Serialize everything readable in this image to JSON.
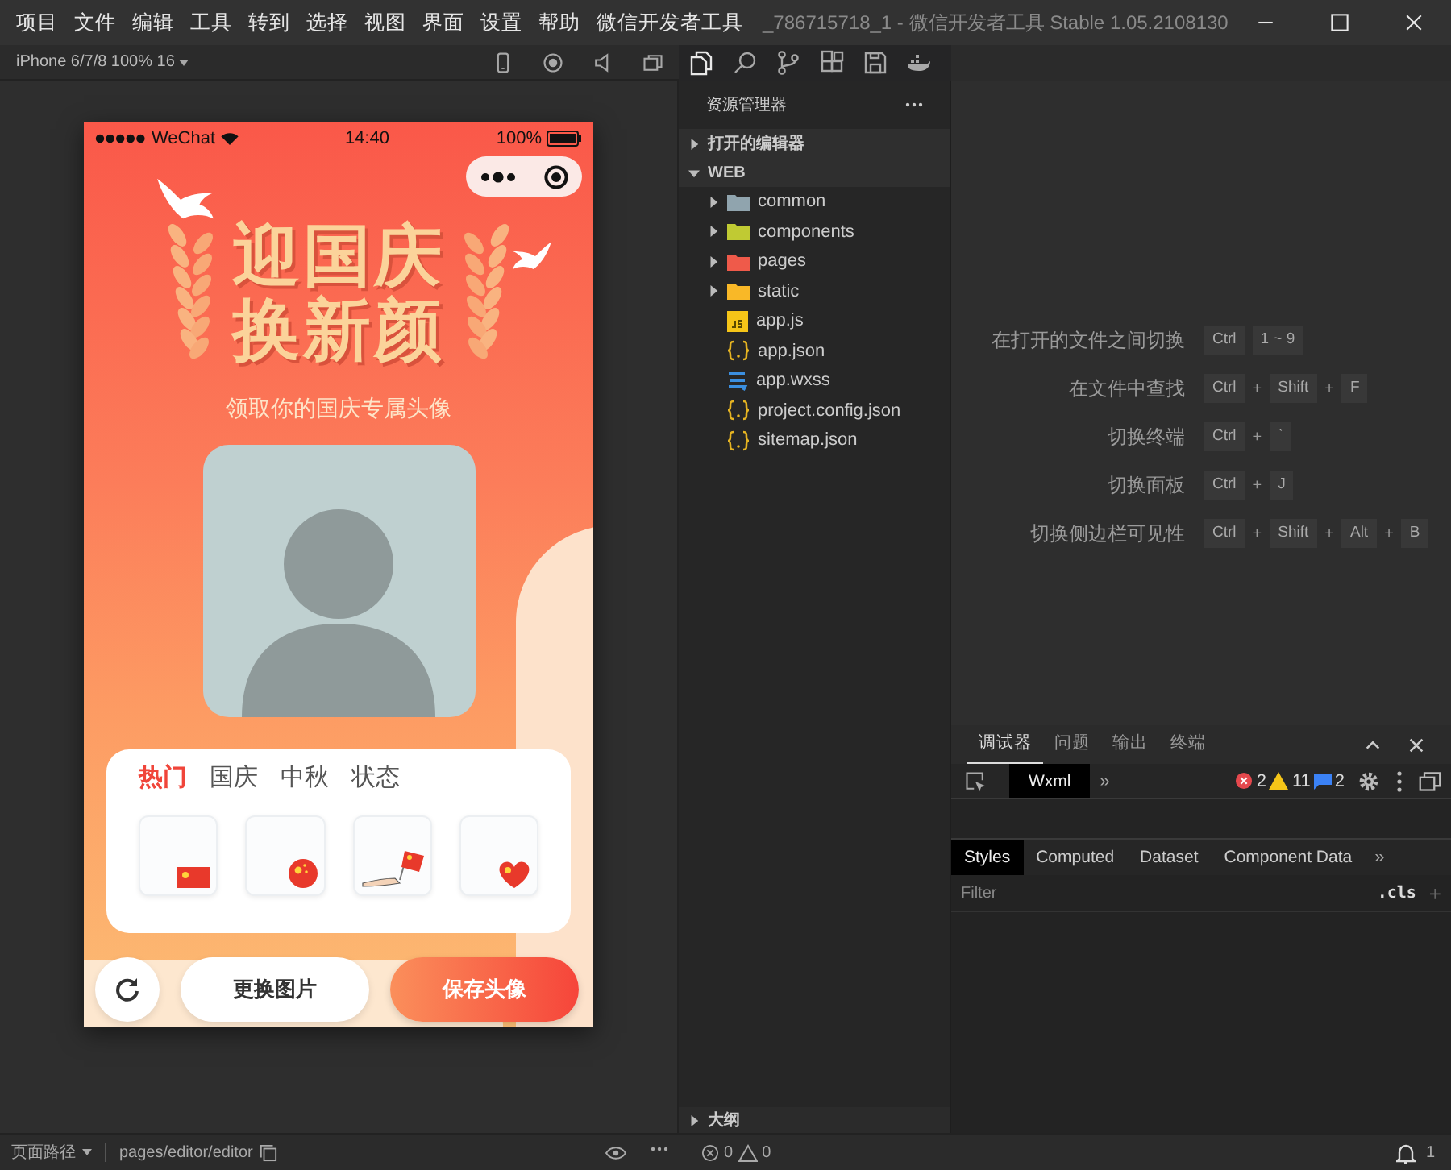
{
  "menu": [
    "项目",
    "文件",
    "编辑",
    "工具",
    "转到",
    "选择",
    "视图",
    "界面",
    "设置",
    "帮助",
    "微信开发者工具"
  ],
  "window": {
    "title": "_786715718_1 - 微信开发者工具 Stable 1.05.2108130"
  },
  "simulator": {
    "device": "iPhone 6/7/8 100% 16"
  },
  "phone": {
    "status": {
      "carrier": "WeChat",
      "time": "14:40",
      "battery": "100%"
    },
    "headline": [
      "迎国庆",
      "换新颜"
    ],
    "subtitle": "领取你的国庆专属头像",
    "tabs": [
      {
        "label": "热门",
        "selected": true
      },
      {
        "label": "国庆",
        "selected": false
      },
      {
        "label": "中秋",
        "selected": false
      },
      {
        "label": "状态",
        "selected": false
      }
    ],
    "frames": [
      {
        "kind": "flag"
      },
      {
        "kind": "badge"
      },
      {
        "kind": "hand-flag"
      },
      {
        "kind": "heart"
      }
    ],
    "buttons": [
      {
        "kind": "refresh"
      },
      {
        "kind": "secondary",
        "label": "更换图片"
      },
      {
        "kind": "primary",
        "label": "保存头像"
      }
    ]
  },
  "explorer": {
    "title": "资源管理器",
    "sections": [
      {
        "label": "打开的编辑器",
        "expanded": false
      },
      {
        "label": "WEB",
        "expanded": true,
        "children": [
          {
            "kind": "folder",
            "label": "common",
            "color": "#90a4ae",
            "expanded": false
          },
          {
            "kind": "folder",
            "label": "components",
            "color": "#c0ca33",
            "expanded": false
          },
          {
            "kind": "folder",
            "label": "pages",
            "color": "#ef5a4a",
            "expanded": false
          },
          {
            "kind": "folder",
            "label": "static",
            "color": "#f9b827",
            "expanded": false
          },
          {
            "kind": "js",
            "label": "app.js"
          },
          {
            "kind": "json",
            "label": "app.json"
          },
          {
            "kind": "wxss",
            "label": "app.wxss"
          },
          {
            "kind": "json",
            "label": "project.config.json"
          },
          {
            "kind": "json",
            "label": "sitemap.json"
          }
        ]
      }
    ],
    "outline": {
      "label": "大纲",
      "expanded": false
    }
  },
  "shortcuts": [
    {
      "label": "在打开的文件之间切换",
      "keys": [
        {
          "kind": "key",
          "text": "Ctrl"
        },
        {
          "kind": "key",
          "text": "1 ~ 9"
        }
      ]
    },
    {
      "label": "在文件中查找",
      "keys": [
        {
          "kind": "key",
          "text": "Ctrl"
        },
        {
          "kind": "plus",
          "text": "+"
        },
        {
          "kind": "key",
          "text": "Shift"
        },
        {
          "kind": "plus",
          "text": "+"
        },
        {
          "kind": "key",
          "text": "F"
        }
      ]
    },
    {
      "label": "切换终端",
      "keys": [
        {
          "kind": "key",
          "text": "Ctrl"
        },
        {
          "kind": "plus",
          "text": "+"
        },
        {
          "kind": "key",
          "text": "`"
        }
      ]
    },
    {
      "label": "切换面板",
      "keys": [
        {
          "kind": "key",
          "text": "Ctrl"
        },
        {
          "kind": "plus",
          "text": "+"
        },
        {
          "kind": "key",
          "text": "J"
        }
      ]
    },
    {
      "label": "切换侧边栏可见性",
      "keys": [
        {
          "kind": "key",
          "text": "Ctrl"
        },
        {
          "kind": "plus",
          "text": "+"
        },
        {
          "kind": "key",
          "text": "Shift"
        },
        {
          "kind": "plus",
          "text": "+"
        },
        {
          "kind": "key",
          "text": "Alt"
        },
        {
          "kind": "plus",
          "text": "+"
        },
        {
          "kind": "key",
          "text": "B"
        }
      ]
    }
  ],
  "debugger": {
    "tabs": [
      {
        "label": "调试器",
        "selected": true
      },
      {
        "label": "问题",
        "selected": false
      },
      {
        "label": "输出",
        "selected": false
      },
      {
        "label": "终端",
        "selected": false
      }
    ],
    "panel_tabs": [
      {
        "label": "Wxml",
        "selected": true
      }
    ],
    "more": "»",
    "errors": "2",
    "warnings": "11",
    "infos": "2",
    "style_tabs": [
      {
        "label": "Styles",
        "selected": true
      },
      {
        "label": "Computed",
        "selected": false
      },
      {
        "label": "Dataset",
        "selected": false
      },
      {
        "label": "Component Data",
        "selected": false
      }
    ],
    "style_more": "»",
    "filter": {
      "placeholder": "Filter"
    },
    "cls": ".cls",
    "add": "+"
  },
  "status_bar": {
    "path_label": "页面路径",
    "path": "pages/editor/editor",
    "errors": "0",
    "warnings": "0",
    "notifications": "1"
  }
}
